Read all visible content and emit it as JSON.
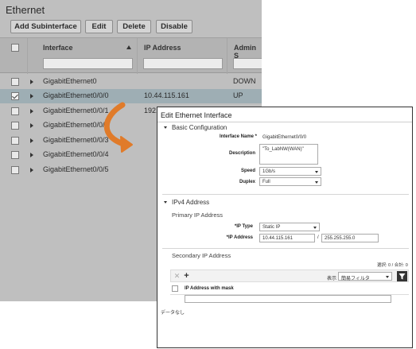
{
  "background": {
    "title": "Ethernet",
    "toolbar": {
      "add_label": "Add Subinterface",
      "edit_label": "Edit",
      "delete_label": "Delete",
      "disable_label": "Disable"
    },
    "columns": [
      "Interface",
      "IP Address",
      "Admin S"
    ],
    "rows": [
      {
        "interface": "GigabitEthernet0",
        "ip": "",
        "admin": "DOWN",
        "checked": false
      },
      {
        "interface": "GigabitEthernet0/0/0",
        "ip": "10.44.115.161",
        "admin": "UP",
        "checked": true
      },
      {
        "interface": "GigabitEthernet0/0/1",
        "ip": "192.",
        "admin": "",
        "checked": false
      },
      {
        "interface": "GigabitEthernet0/0/2",
        "ip": "",
        "admin": "",
        "checked": false
      },
      {
        "interface": "GigabitEthernet0/0/3",
        "ip": "",
        "admin": "",
        "checked": false
      },
      {
        "interface": "GigabitEthernet0/0/4",
        "ip": "",
        "admin": "",
        "checked": false
      },
      {
        "interface": "GigabitEthernet0/0/5",
        "ip": "",
        "admin": "",
        "checked": false
      }
    ]
  },
  "dialog": {
    "title": "Edit Ethernet Interface",
    "basic": {
      "header": "Basic Configuration",
      "interface_name_label": "Interface Name *",
      "interface_name_value": "GigabitEthernet0/0/0",
      "description_label": "Description",
      "description_value": "\"To_LabNW(WAN)\"",
      "speed_label": "Speed",
      "speed_value": "1Gb/s",
      "duplex_label": "Duplex",
      "duplex_value": "Full"
    },
    "ipv4": {
      "header": "IPv4 Address",
      "primary_header": "Primary IP Address",
      "ip_type_label": "*IP Type",
      "ip_type_value": "Static IP",
      "ip_address_label": "*IP Address",
      "ip_address_value": "10.44.115.161",
      "slash": "/",
      "mask_value": "255.255.255.0",
      "secondary_header": "Secondary IP Address",
      "selected_count": "選択: 0 / 合計: 0",
      "display_label": "表示",
      "filter_value": "簡易フィルタ",
      "col_header": "IP Address with mask",
      "empty_text": "データなし"
    }
  },
  "colors": {
    "background_panel": "#bfbfbf",
    "selected_row": "#9eaeb4",
    "arrow": "#e07b2a"
  }
}
